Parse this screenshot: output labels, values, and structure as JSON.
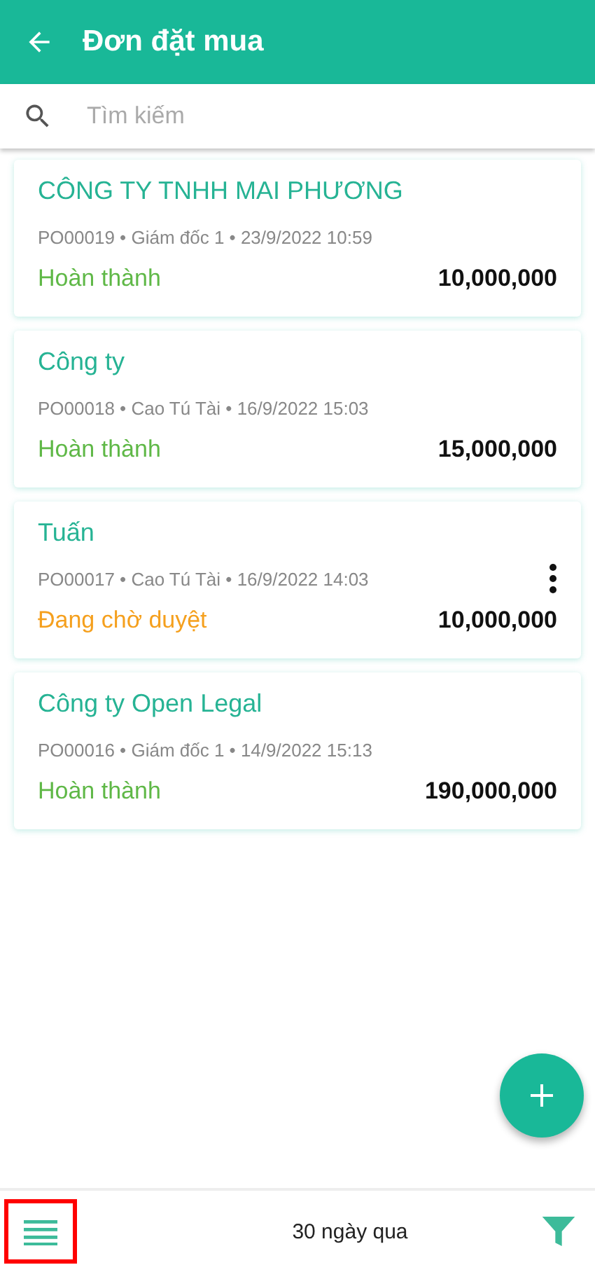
{
  "header": {
    "title": "Đơn đặt mua"
  },
  "search": {
    "placeholder": "Tìm kiếm"
  },
  "orders": [
    {
      "name": "CÔNG TY TNHH MAI PHƯƠNG",
      "meta": "PO00019 • Giám đốc 1 • 23/9/2022 10:59",
      "status": "Hoàn thành",
      "color": "#5fb847",
      "amount": "10,000,000",
      "has_menu": false
    },
    {
      "name": "Công ty",
      "meta": "PO00018 • Cao Tú Tài • 16/9/2022 15:03",
      "status": "Hoàn thành",
      "color": "#5fb847",
      "amount": "15,000,000",
      "has_menu": false
    },
    {
      "name": "Tuấn",
      "meta": "PO00017 • Cao Tú Tài • 16/9/2022 14:03",
      "status": "Đang chờ duyệt",
      "color": "#f5a01e",
      "amount": "10,000,000",
      "has_menu": true
    },
    {
      "name": "Công ty Open Legal",
      "meta": "PO00016 • Giám đốc 1 • 14/9/2022 15:13",
      "status": "Hoàn thành",
      "color": "#5fb847",
      "amount": "190,000,000",
      "has_menu": false
    }
  ],
  "bottom_bar": {
    "period": "30 ngày qua",
    "menu_highlighted": true
  }
}
